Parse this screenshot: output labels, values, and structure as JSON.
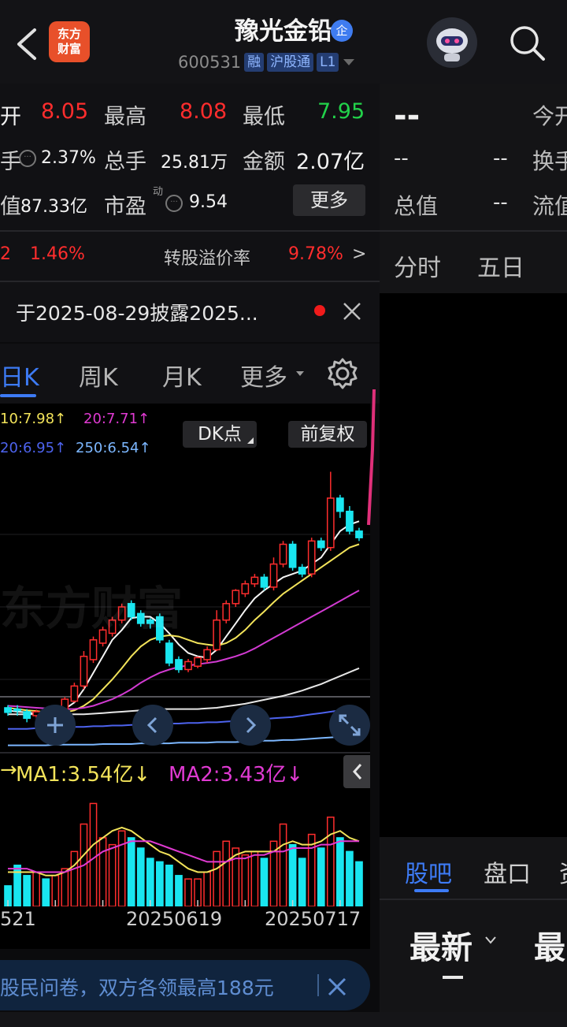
{
  "header": {
    "logo_line1": "东方",
    "logo_line2": "财富",
    "stock_name": "豫光金铅",
    "qi_badge": "企",
    "code": "600531",
    "tags": [
      "融",
      "沪股通",
      "L1"
    ]
  },
  "quote": {
    "open_label": "开",
    "open_value": "8.05",
    "high_label": "最高",
    "high_value": "8.08",
    "low_label": "最低",
    "low_value": "7.95",
    "turnover_label": "手",
    "turnover_value": "2.37%",
    "volume_label": "总手",
    "volume_value": "25.81万",
    "amount_label": "金额",
    "amount_value": "2.07亿",
    "mcap_label": "值",
    "mcap_value": "87.33亿",
    "pe_label": "市盈",
    "pe_sup": "动",
    "pe_value": "9.54",
    "more_label": "更多",
    "row4_left": "2",
    "row4_pct": "1.46%",
    "premium_label": "转股溢价率",
    "premium_value": "9.78%"
  },
  "notice": {
    "text": "于2025-08-29披露2025..."
  },
  "ktabs": [
    "日K",
    "周K",
    "月K",
    "更多"
  ],
  "chart_data": {
    "type": "candlestick",
    "ma_labels": {
      "ma10": "10:7.98↑",
      "ma20": "20:7.71↑",
      "ma60": "20:6.95↑",
      "ma250": "250:6.54↑"
    },
    "dk_label": "DK点",
    "adjust_label": "前复权",
    "volume_ma1": "MA1:3.54亿↓",
    "volume_ma2": "MA2:3.43亿↓",
    "date_labels": [
      "521",
      "20250619",
      "20250717"
    ],
    "candles": [
      {
        "o": 5.02,
        "c": 4.95,
        "h": 5.06,
        "l": 4.9
      },
      {
        "o": 5.0,
        "c": 4.98,
        "h": 5.06,
        "l": 4.9
      },
      {
        "o": 4.96,
        "c": 4.86,
        "h": 5.0,
        "l": 4.8
      },
      {
        "o": 4.9,
        "c": 4.96,
        "h": 4.99,
        "l": 4.85
      },
      {
        "o": 4.95,
        "c": 4.88,
        "h": 5.0,
        "l": 4.84
      },
      {
        "o": 4.9,
        "c": 5.02,
        "h": 5.05,
        "l": 4.88
      },
      {
        "o": 5.0,
        "c": 5.15,
        "h": 5.18,
        "l": 4.98
      },
      {
        "o": 5.12,
        "c": 5.35,
        "h": 5.4,
        "l": 5.1
      },
      {
        "o": 5.35,
        "c": 5.8,
        "h": 5.88,
        "l": 5.3
      },
      {
        "o": 5.75,
        "c": 6.05,
        "h": 6.1,
        "l": 5.7
      },
      {
        "o": 6.0,
        "c": 6.2,
        "h": 6.25,
        "l": 5.95
      },
      {
        "o": 6.15,
        "c": 6.35,
        "h": 6.4,
        "l": 6.1
      },
      {
        "o": 6.35,
        "c": 6.55,
        "h": 6.6,
        "l": 6.3
      },
      {
        "o": 6.6,
        "c": 6.4,
        "h": 6.65,
        "l": 6.35
      },
      {
        "o": 6.45,
        "c": 6.3,
        "h": 6.5,
        "l": 6.25
      },
      {
        "o": 6.35,
        "c": 6.3,
        "h": 6.38,
        "l": 6.22
      },
      {
        "o": 6.4,
        "c": 6.05,
        "h": 6.45,
        "l": 6.0
      },
      {
        "o": 6.0,
        "c": 5.7,
        "h": 6.05,
        "l": 5.65
      },
      {
        "o": 5.75,
        "c": 5.6,
        "h": 5.8,
        "l": 5.55
      },
      {
        "o": 5.6,
        "c": 5.72,
        "h": 5.76,
        "l": 5.56
      },
      {
        "o": 5.65,
        "c": 5.78,
        "h": 5.8,
        "l": 5.62
      },
      {
        "o": 5.75,
        "c": 5.9,
        "h": 5.95,
        "l": 5.7
      },
      {
        "o": 5.9,
        "c": 6.35,
        "h": 6.5,
        "l": 5.88
      },
      {
        "o": 6.35,
        "c": 6.6,
        "h": 6.65,
        "l": 6.3
      },
      {
        "o": 6.6,
        "c": 6.8,
        "h": 6.82,
        "l": 6.55
      },
      {
        "o": 6.75,
        "c": 6.9,
        "h": 6.95,
        "l": 6.7
      },
      {
        "o": 6.9,
        "c": 7.0,
        "h": 7.05,
        "l": 6.85
      },
      {
        "o": 7.0,
        "c": 6.85,
        "h": 7.05,
        "l": 6.8
      },
      {
        "o": 6.85,
        "c": 7.2,
        "h": 7.3,
        "l": 6.8
      },
      {
        "o": 7.2,
        "c": 7.5,
        "h": 7.55,
        "l": 7.15
      },
      {
        "o": 7.5,
        "c": 7.15,
        "h": 7.55,
        "l": 7.1
      },
      {
        "o": 7.15,
        "c": 7.05,
        "h": 7.2,
        "l": 7.0
      },
      {
        "o": 7.05,
        "c": 7.55,
        "h": 7.6,
        "l": 7.0
      },
      {
        "o": 7.55,
        "c": 7.45,
        "h": 7.6,
        "l": 7.4
      },
      {
        "o": 7.45,
        "c": 8.2,
        "h": 8.6,
        "l": 7.4
      },
      {
        "o": 8.2,
        "c": 8.0,
        "h": 8.25,
        "l": 7.9
      },
      {
        "o": 8.0,
        "c": 7.7,
        "h": 8.08,
        "l": 7.65
      },
      {
        "o": 7.7,
        "c": 7.6,
        "h": 7.75,
        "l": 7.55
      }
    ],
    "ma_series": {
      "ma5": [
        4.98,
        4.96,
        4.95,
        4.93,
        4.92,
        4.94,
        5.0,
        5.1,
        5.3,
        5.55,
        5.8,
        6.05,
        6.2,
        6.38,
        6.4,
        6.4,
        6.3,
        6.15,
        5.98,
        5.85,
        5.8,
        5.78,
        5.9,
        6.1,
        6.3,
        6.5,
        6.68,
        6.8,
        6.9,
        7.0,
        7.05,
        7.1,
        7.2,
        7.3,
        7.5,
        7.7,
        7.8,
        7.85
      ],
      "ma10": [
        5.02,
        5.0,
        4.98,
        4.97,
        4.95,
        4.94,
        4.95,
        4.98,
        5.05,
        5.15,
        5.3,
        5.45,
        5.62,
        5.8,
        5.95,
        6.05,
        6.1,
        6.12,
        6.1,
        6.05,
        6.0,
        5.98,
        5.96,
        6.0,
        6.08,
        6.2,
        6.35,
        6.48,
        6.62,
        6.75,
        6.85,
        6.95,
        7.05,
        7.15,
        7.25,
        7.35,
        7.45,
        7.5
      ],
      "ma20": [
        5.05,
        5.04,
        5.03,
        5.02,
        5.01,
        5.0,
        5.0,
        5.0,
        5.02,
        5.05,
        5.1,
        5.15,
        5.22,
        5.3,
        5.4,
        5.48,
        5.55,
        5.6,
        5.64,
        5.66,
        5.68,
        5.7,
        5.72,
        5.76,
        5.8,
        5.85,
        5.92,
        6.0,
        6.08,
        6.16,
        6.24,
        6.32,
        6.4,
        6.48,
        6.56,
        6.64,
        6.72,
        6.8
      ],
      "ma60": [
        4.92,
        4.92,
        4.92,
        4.92,
        4.92,
        4.92,
        4.92,
        4.92,
        4.92,
        4.93,
        4.94,
        4.95,
        4.96,
        4.97,
        4.98,
        4.99,
        5.0,
        5.0,
        5.0,
        5.0,
        5.0,
        5.01,
        5.02,
        5.04,
        5.06,
        5.08,
        5.11,
        5.14,
        5.17,
        5.2,
        5.24,
        5.28,
        5.33,
        5.38,
        5.44,
        5.5,
        5.56,
        5.62
      ],
      "ma120": [
        4.7,
        4.7,
        4.7,
        4.71,
        4.71,
        4.72,
        4.72,
        4.73,
        4.73,
        4.74,
        4.74,
        4.75,
        4.75,
        4.76,
        4.76,
        4.77,
        4.77,
        4.78,
        4.78,
        4.79,
        4.79,
        4.8,
        4.8,
        4.81,
        4.82,
        4.83,
        4.84,
        4.85,
        4.86,
        4.87,
        4.88,
        4.9,
        4.92,
        4.94,
        4.96,
        4.98,
        5.0,
        5.02
      ],
      "ma250": [
        4.45,
        4.45,
        4.45,
        4.45,
        4.45,
        4.46,
        4.46,
        4.46,
        4.46,
        4.46,
        4.47,
        4.47,
        4.47,
        4.47,
        4.48,
        4.48,
        4.48,
        4.48,
        4.49,
        4.49,
        4.49,
        4.49,
        4.5,
        4.5,
        4.5,
        4.51,
        4.51,
        4.52,
        4.52,
        4.53,
        4.53,
        4.54,
        4.55,
        4.56,
        4.57,
        4.58,
        4.59,
        4.6
      ]
    },
    "volumes": [
      0.6,
      1.2,
      0.9,
      1.0,
      0.8,
      0.9,
      1.1,
      1.6,
      2.4,
      3.0,
      2.0,
      1.8,
      2.2,
      2.0,
      1.7,
      1.4,
      1.3,
      1.2,
      0.9,
      0.8,
      0.8,
      1.0,
      1.6,
      1.9,
      1.7,
      1.5,
      1.6,
      1.4,
      1.9,
      2.4,
      1.8,
      1.4,
      2.1,
      1.7,
      2.6,
      2.0,
      1.6,
      1.3
    ],
    "vol_ma1": [
      1.0,
      1.0,
      1.0,
      1.0,
      0.9,
      0.9,
      1.0,
      1.2,
      1.5,
      1.8,
      2.0,
      2.2,
      2.3,
      2.2,
      2.0,
      1.8,
      1.6,
      1.5,
      1.3,
      1.1,
      1.0,
      1.0,
      1.1,
      1.3,
      1.5,
      1.6,
      1.6,
      1.6,
      1.6,
      1.8,
      1.9,
      1.8,
      1.8,
      1.9,
      2.1,
      2.2,
      2.0,
      1.9
    ],
    "vol_ma2": [
      1.1,
      1.1,
      1.1,
      1.0,
      1.0,
      1.0,
      1.0,
      1.1,
      1.2,
      1.4,
      1.6,
      1.7,
      1.8,
      1.9,
      1.9,
      1.9,
      1.8,
      1.7,
      1.6,
      1.5,
      1.4,
      1.3,
      1.3,
      1.3,
      1.4,
      1.4,
      1.5,
      1.5,
      1.6,
      1.6,
      1.7,
      1.7,
      1.7,
      1.8,
      1.8,
      1.9,
      1.9,
      1.9
    ]
  },
  "right_panel": {
    "big_dash": "--",
    "row1_label": "今开",
    "row2_left": "--",
    "row2_mid": "--",
    "row2_label": "换手",
    "row3_label": "总值",
    "row3_value": "--",
    "row3_label2": "流值",
    "tab1": "分时",
    "tab2": "五日",
    "bottom_tab1": "股吧",
    "bottom_tab2": "盘口",
    "bottom_tab3": "资",
    "sort1": "最新",
    "sort2": "最"
  },
  "banner": {
    "text": "股民问卷，双方各领最高188元"
  }
}
